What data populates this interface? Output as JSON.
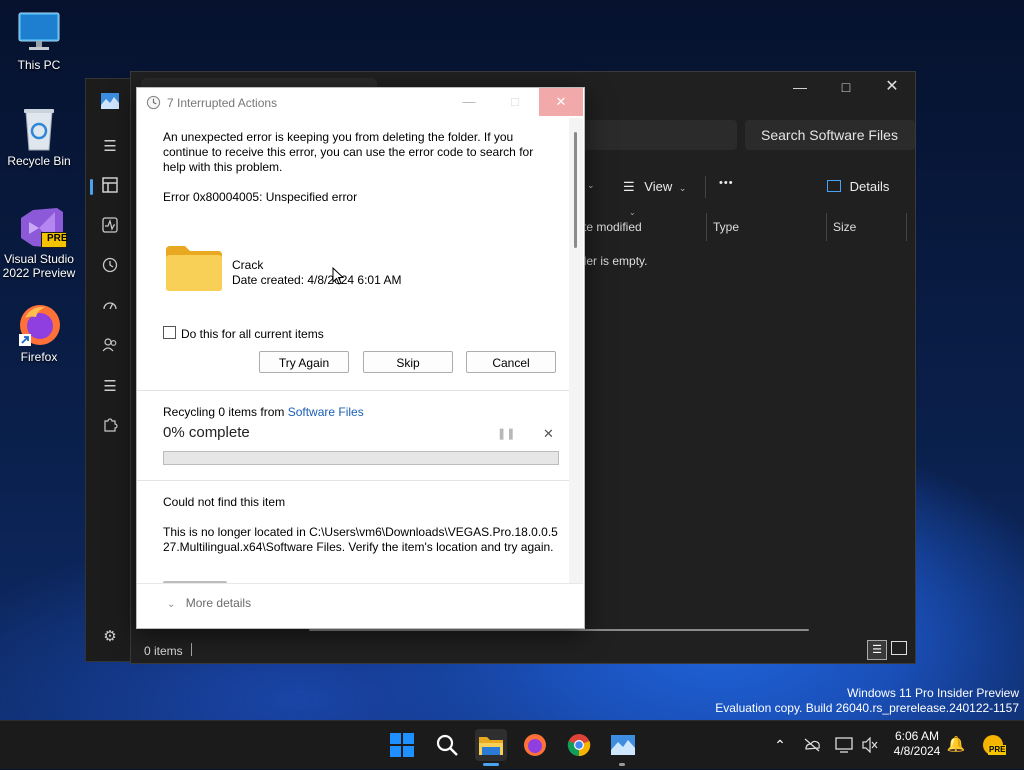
{
  "desktop": {
    "icons": [
      {
        "label": "This PC",
        "icon": "monitor-icon"
      },
      {
        "label": "Recycle Bin",
        "icon": "recycle-bin-icon"
      },
      {
        "label": "Visual Studio 2022 Preview",
        "icon": "visual-studio-icon",
        "badge": "PRE"
      },
      {
        "label": "Firefox",
        "icon": "firefox-icon"
      }
    ],
    "watermark": {
      "line1": "Windows 11 Pro Insider Preview",
      "line2": "Evaluation copy. Build 26040.rs_prerelease.240122-1157"
    }
  },
  "explorer": {
    "search_placeholder": "Search Software Files",
    "toolbar": {
      "view_label": "View",
      "more_label": "•••",
      "details_label": "Details"
    },
    "columns": [
      "te modified",
      "Type",
      "Size"
    ],
    "empty_message": "lder is empty.",
    "status": {
      "items_label": "0 items"
    }
  },
  "dialog": {
    "title": "7 Interrupted Actions",
    "error_message": "An unexpected error is keeping you from deleting the folder. If you continue to receive this error, you can use the error code to search for help with this problem.",
    "error_code": "Error 0x80004005: Unspecified error",
    "item": {
      "name": "Crack",
      "date_created": "Date created: 4/8/2024 6:01 AM"
    },
    "checkbox_label": "Do this for all current items",
    "buttons": {
      "try_again": "Try Again",
      "skip": "Skip",
      "cancel": "Cancel"
    },
    "recycle": {
      "prefix": "Recycling 0 items from ",
      "link": "Software Files",
      "percent_text": "0% complete",
      "progress": 0
    },
    "not_found": {
      "title": "Could not find this item",
      "body": "This is no longer located in C:\\Users\\vm6\\Downloads\\VEGAS.Pro.18.0.0.527.Multilingual.x64\\Software Files. Verify the item's location and try again."
    },
    "more_details": "More details"
  },
  "taskbar": {
    "clock_time": "6:06 AM",
    "clock_date": "4/8/2024",
    "badge": "PRE"
  },
  "colors": {
    "accent_link": "#1a5fb4",
    "folder_yellow": "#f4c542",
    "explorer_bg": "#202020",
    "taskbar_bg": "#1b1b1b"
  }
}
